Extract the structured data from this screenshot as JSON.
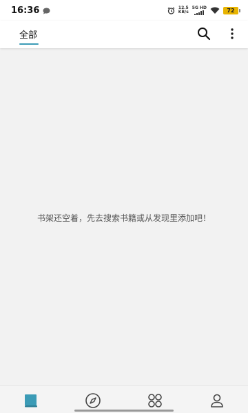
{
  "status_bar": {
    "time": "16:36",
    "net_speed_value": "12.5",
    "net_speed_unit": "KB/s",
    "net_type": "5G HD",
    "battery": "72"
  },
  "app_bar": {
    "tab_all": "全部",
    "accent_color": "#3b9bb6"
  },
  "content": {
    "empty_message": "书架还空着，先去搜索书籍或从发现里添加吧！"
  },
  "bottom_nav": {
    "items": [
      {
        "icon": "bookshelf-icon",
        "active": true
      },
      {
        "icon": "compass-icon",
        "active": false
      },
      {
        "icon": "grid-icon",
        "active": false
      },
      {
        "icon": "user-icon",
        "active": false
      }
    ]
  }
}
